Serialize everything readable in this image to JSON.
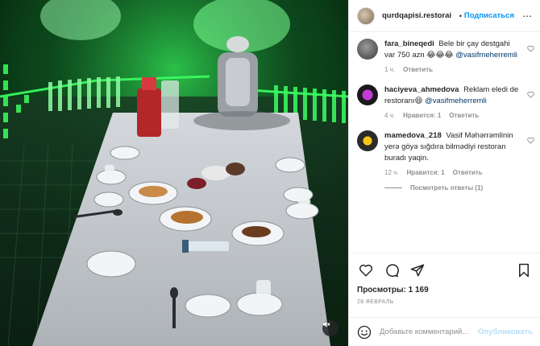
{
  "post": {
    "username": "qurdqapisi.restorai",
    "follow_label": "Подписаться",
    "more_icon": "more-horizontal-icon"
  },
  "comments": [
    {
      "user": "fara_bineqedi",
      "text": "Bele bir çay destgahi var 750 azn 😂😂😂",
      "mention": "@vasifmeherremli",
      "time": "1 ч.",
      "likes": "",
      "reply_label": "Ответить",
      "avatar_color": "#4a4a4a"
    },
    {
      "user": "haciyeva_ahmedova",
      "text": "Reklam eledi de restoranı😆",
      "mention": "@vasifmeherremli",
      "time": "4 ч.",
      "likes": "Нравится: 1",
      "reply_label": "Ответить",
      "avatar_color": "#1f1f1f"
    },
    {
      "user": "mamedova_218",
      "text": "Vasif Məhərrəmlinin yerə göyə sığdıra bilmədiyi restoran buradı yaqin.",
      "mention": "",
      "time": "12 ч.",
      "likes": "Нравится: 1",
      "reply_label": "Ответить",
      "avatar_color": "#2b2b2b"
    }
  ],
  "view_replies_label": "Посмотреть ответы (1)",
  "stats": {
    "views_label": "Просмотры: 1 169",
    "date": "28 ФЕВРАЛЬ"
  },
  "composer": {
    "placeholder": "Добавьте комментарий...",
    "publish_label": "Опубликовать"
  },
  "colors": {
    "accent": "#0095f6",
    "neon_green": "#39ff5a",
    "muted_text": "#8e8e8e"
  }
}
